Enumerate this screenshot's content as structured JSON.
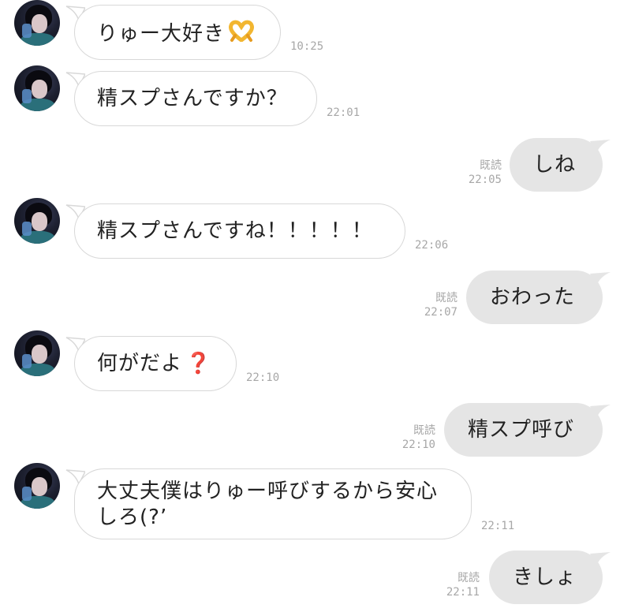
{
  "messages": [
    {
      "side": "in",
      "text": "りゅー大好き",
      "emoji": "heart-hands",
      "time": "10:25"
    },
    {
      "side": "in",
      "text": "精スプさんですか？",
      "time": "22:01"
    },
    {
      "side": "out",
      "text": "しね",
      "read": "既読",
      "time": "22:05"
    },
    {
      "side": "in",
      "text": "精スプさんですね！！！！！",
      "time": "22:06"
    },
    {
      "side": "out",
      "text": "おわった",
      "read": "既読",
      "time": "22:07"
    },
    {
      "side": "in",
      "text": "何がだよ",
      "emoji": "red-question-mark",
      "emoji_char": "❓",
      "time": "22:10"
    },
    {
      "side": "out",
      "text": "精スプ呼び",
      "read": "既読",
      "time": "22:10"
    },
    {
      "side": "in",
      "text_line1": "大丈夫僕はりゅー呼びするから安心",
      "text_line2": "しろ(?’",
      "time": "22:11"
    },
    {
      "side": "out",
      "text": "きしょ",
      "read": "既読",
      "time": "22:11"
    }
  ],
  "colors": {
    "incoming_bubble": "#ffffff",
    "incoming_border": "#d8d8d8",
    "outgoing_bubble": "#e5e5e5",
    "timestamp": "#a7a7a7",
    "text": "#222222",
    "emoji_heart_hands": "#f2b630",
    "emoji_question": "#e0203a"
  }
}
